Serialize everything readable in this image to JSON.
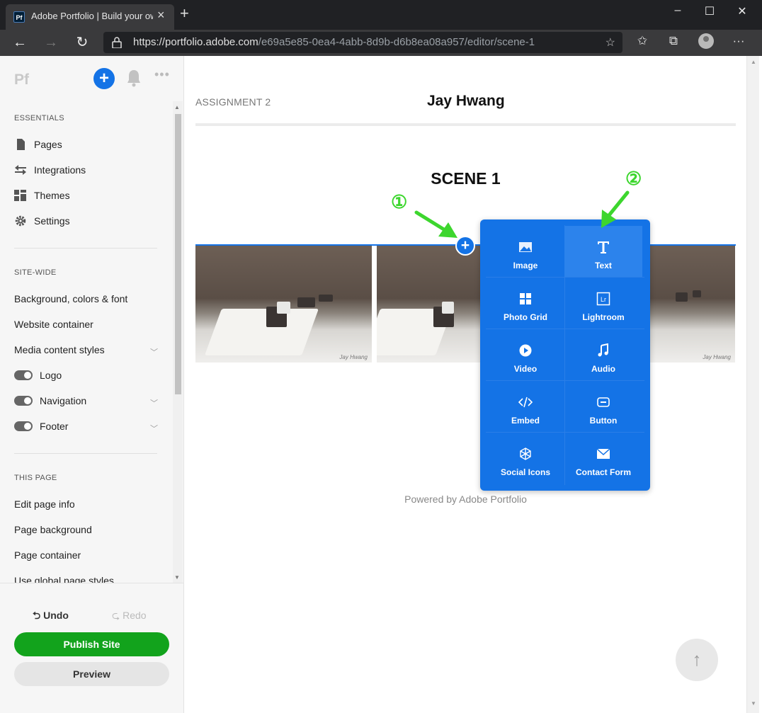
{
  "browser": {
    "tab_title": "Adobe Portfolio | Build your own",
    "tab_favicon": "Pf",
    "url_host": "https://portfolio.adobe.com",
    "url_path": "/e69a5e85-0ea4-4abb-8d9b-d6b8ea08a957/editor/scene-1"
  },
  "sidebar": {
    "logo": "Pf",
    "essentials_heading": "ESSENTIALS",
    "essentials": [
      "Pages",
      "Integrations",
      "Themes",
      "Settings"
    ],
    "sitewide_heading": "SITE-WIDE",
    "sitewide": [
      "Background, colors & font",
      "Website container",
      "Media content styles"
    ],
    "toggles": [
      "Logo",
      "Navigation",
      "Footer"
    ],
    "thispage_heading": "THIS PAGE",
    "thispage": [
      "Edit page info",
      "Page background",
      "Page container",
      "Use global page styles"
    ],
    "undo_label": "Undo",
    "redo_label": "Redo",
    "publish_label": "Publish Site",
    "preview_label": "Preview"
  },
  "page": {
    "assignment": "ASSIGNMENT 2",
    "site_title": "Jay Hwang",
    "scene_title": "SCENE 1",
    "powered_by": "Powered by Adobe Portfolio",
    "watermark": "Jay Hwang"
  },
  "insert_menu": {
    "items": [
      "Image",
      "Text",
      "Photo Grid",
      "Lightroom",
      "Video",
      "Audio",
      "Embed",
      "Button",
      "Social Icons",
      "Contact Form"
    ],
    "highlighted": "Text"
  },
  "annotations": {
    "one": "①",
    "two": "②",
    "color": "#3dd62e"
  },
  "colors": {
    "accent": "#1473e6",
    "publish": "#12a31c"
  }
}
